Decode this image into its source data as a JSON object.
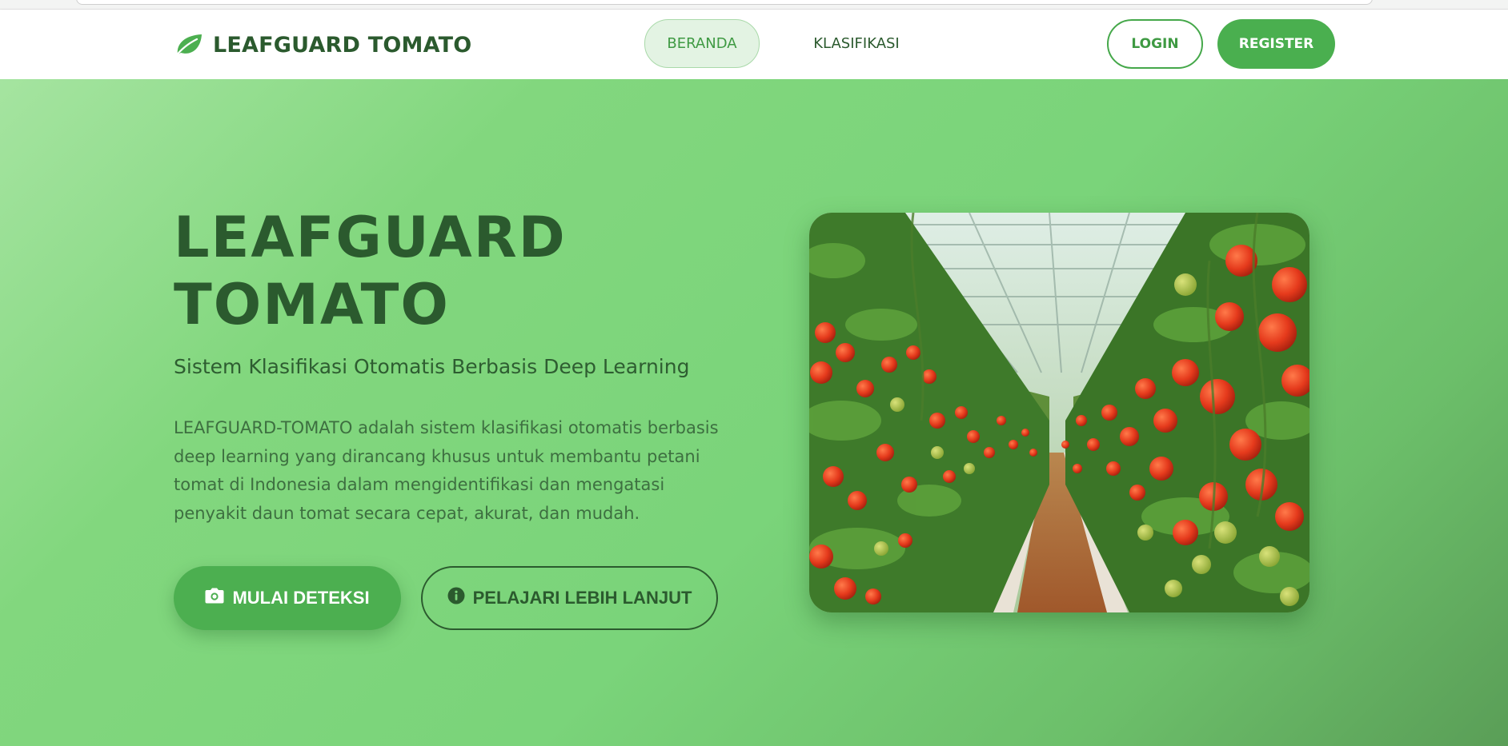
{
  "brand": {
    "name": "LEAFGUARD TOMATO",
    "icon": "leaf-icon"
  },
  "nav": {
    "items": [
      {
        "label": "BERANDA",
        "active": true
      },
      {
        "label": "KLASIFIKASI",
        "active": false
      }
    ],
    "login_label": "LOGIN",
    "register_label": "REGISTER"
  },
  "hero": {
    "title_line1": "LEAFGUARD",
    "title_line2": "TOMATO",
    "subtitle": "Sistem Klasifikasi Otomatis Berbasis Deep Learning",
    "description": "LEAFGUARD-TOMATO adalah sistem klasifikasi otomatis berbasis deep learning yang dirancang khusus untuk membantu petani tomat di Indonesia dalam mengidentifikasi dan mengatasi penyakit daun tomat secara cepat, akurat, dan mudah.",
    "primary_button": {
      "label": "MULAI DETEKSI",
      "icon": "camera-icon"
    },
    "secondary_button": {
      "label": "PELAJARI LEBIH LANJUT",
      "icon": "info-icon"
    },
    "image": {
      "subject": "tomato greenhouse rows"
    }
  },
  "colors": {
    "brand_dark": "#2b5a2e",
    "accent": "#4caf50",
    "hero_bg": "#7ad47a"
  }
}
